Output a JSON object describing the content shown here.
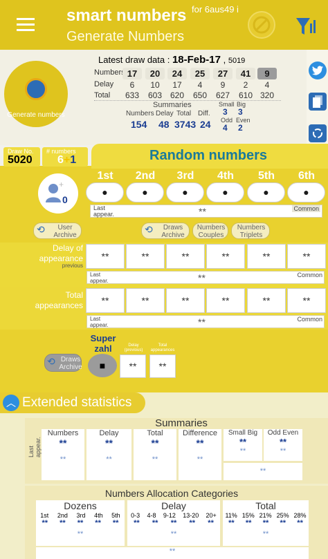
{
  "header": {
    "title": "smart numbers",
    "lottery": "for 6aus49 i",
    "subtitle": "Generate Numbers"
  },
  "generate": {
    "label": "Generate numbers"
  },
  "draw": {
    "prefix": "Latest draw data : ",
    "date": "18-Feb-17",
    "sep": " , ",
    "id": "5019",
    "numbers_label": "Numbers",
    "delay_label": "Delay",
    "total_label": "Total",
    "numbers": [
      "17",
      "20",
      "24",
      "25",
      "27",
      "41",
      "9"
    ],
    "delays": [
      "6",
      "10",
      "17",
      "4",
      "9",
      "2",
      "4"
    ],
    "totals": [
      "633",
      "603",
      "620",
      "650",
      "627",
      "610",
      "320"
    ],
    "summaries": {
      "title": "Summaries",
      "numbers_label": "Numbers",
      "delay_label": "Delay",
      "total_label": "Total",
      "diff_label": "Diff.",
      "numbers": "154",
      "delay": "48",
      "total": "3743",
      "diff": "24",
      "small_label": "Small",
      "big_label": "Big",
      "small": "3",
      "big": "3",
      "odd_label": "Odd",
      "even_label": "Even",
      "odd": "4",
      "even": "2"
    }
  },
  "tabs": {
    "draw_no_label": "Draw No.",
    "draw_no": "5020",
    "count_label": "# numbers",
    "count_main": "6",
    "count_plus": "+",
    "count_extra": "1"
  },
  "random": {
    "title": "Random numbers",
    "positions": [
      "1st",
      "2nd",
      "3rd",
      "4th",
      "5th",
      "6th"
    ],
    "ball_values": [
      "●",
      "●",
      "●",
      "●",
      "●",
      "●"
    ],
    "last_label": "Last appear.",
    "common_label": "Common",
    "placeholder": "**",
    "small": "**",
    "user_count": "0"
  },
  "buttons": {
    "user_archive": "User Archive",
    "draws_archive": "Draws Archive",
    "couples": "Numbers Couples",
    "triplets": "Numbers Triplets"
  },
  "delay_section": {
    "label": "Delay of appearance",
    "sub": "previous"
  },
  "total_section": {
    "label": "Total appearances"
  },
  "super": {
    "label": "Super zahl",
    "ball": "■",
    "draws_archive": "Draws Archive",
    "delay_label": "Delay (previous)",
    "total_label": "Total appearances"
  },
  "extended": {
    "title": "Extended statistics",
    "summaries": {
      "title": "Summaries",
      "cols": [
        "Numbers",
        "Delay",
        "Total",
        "Difference",
        "Small Big",
        "Odd Even"
      ],
      "last_label": "Last appear."
    },
    "alloc": {
      "title": "Numbers Allocation Categories",
      "dozens": "Dozens",
      "delay": "Delay",
      "total": "Total",
      "dozens_cols": [
        "1st",
        "2nd",
        "3rd",
        "4th",
        "5th"
      ],
      "delay_cols": [
        "0-3",
        "4-8",
        "9-12",
        "13-20",
        "20+"
      ],
      "total_cols": [
        "11%",
        "15%",
        "21%",
        "25%",
        "28%"
      ]
    }
  }
}
